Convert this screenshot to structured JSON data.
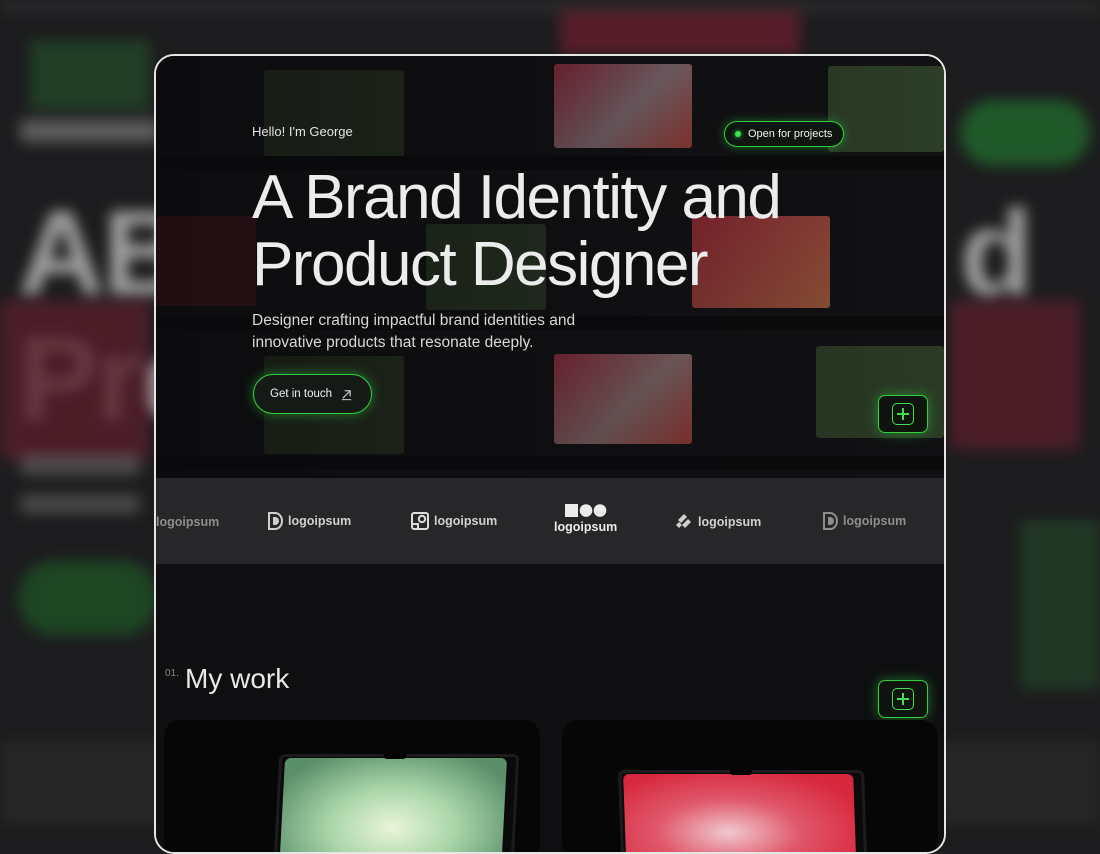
{
  "hero": {
    "greeting": "Hello! I'm George",
    "status_badge": "Open for projects",
    "headline_line1": "A Brand Identity and",
    "headline_line2": "Product Designer",
    "subtitle_line1": "Designer crafting impactful brand identities and",
    "subtitle_line2": "innovative products that resonate deeply.",
    "cta_label": "Get in touch"
  },
  "logo_strip": {
    "logos": [
      "logoipsum",
      "logoipsum",
      "logoipsum",
      "logoipsum",
      "logoipsum",
      "logoipsum"
    ]
  },
  "work": {
    "section_number": "01.",
    "section_title": "My work"
  },
  "colors": {
    "accent": "#2fcf3f",
    "background": "#111113",
    "logo_strip_bg": "#272729"
  },
  "icons": [
    "arrow-up-right-icon",
    "plus-icon",
    "status-dot-icon"
  ]
}
